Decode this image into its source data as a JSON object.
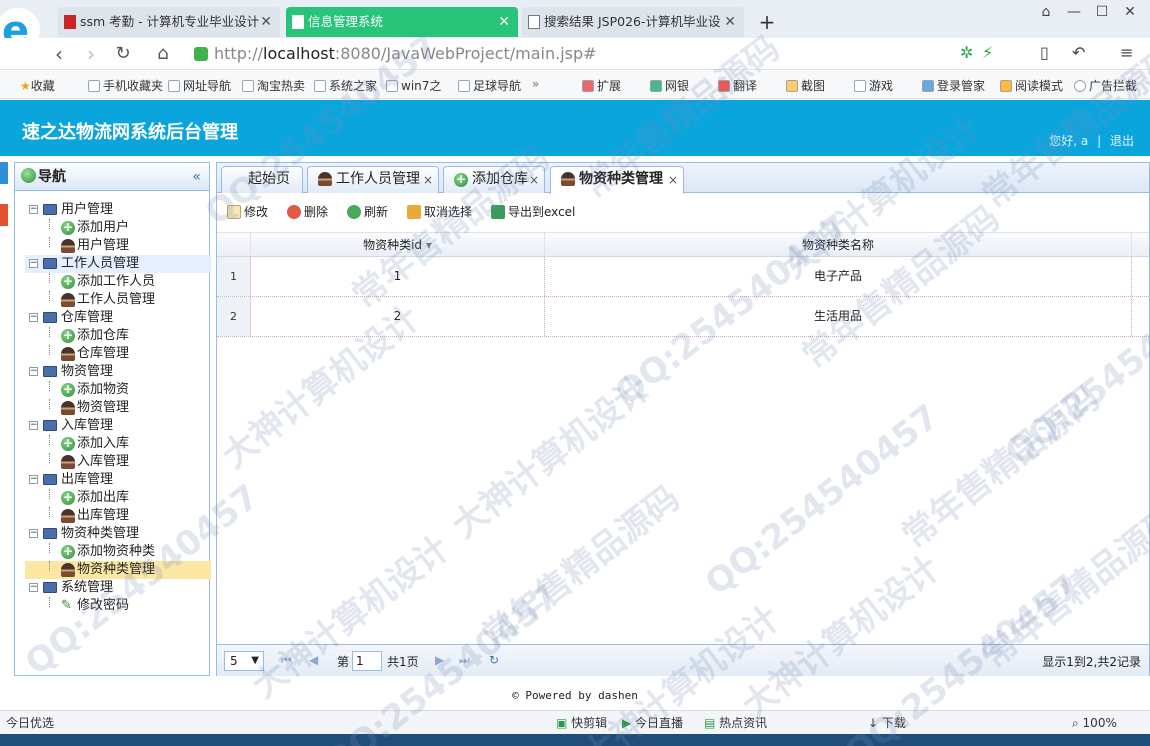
{
  "browser": {
    "tabs": [
      {
        "label": "ssm 考勤 - 计算机专业毕业设计"
      },
      {
        "label": "信息管理系统"
      },
      {
        "label": "搜索结果 JSP026-计算机毕业设"
      }
    ],
    "url_prefix": "http://",
    "url_host": "localhost",
    "url_rest": ":8080/JavaWebProject/main.jsp#",
    "bookmarks": [
      "收藏",
      "手机收藏夹",
      "网址导航",
      "淘宝热卖",
      "系统之家",
      "win7之",
      "足球导航",
      "扩展",
      "网银",
      "翻译",
      "截图",
      "游戏",
      "登录管家",
      "阅读模式",
      "广告拦截"
    ],
    "more_label": "»"
  },
  "app": {
    "title": "速之达物流网系统后台管理",
    "greeting": "您好, a",
    "separator": "|",
    "logout": "退出"
  },
  "nav": {
    "title": "导航",
    "collapse": "«",
    "tree": [
      {
        "label": "用户管理",
        "children": [
          {
            "label": "添加用户",
            "icon": "plus"
          },
          {
            "label": "用户管理",
            "icon": "user"
          }
        ]
      },
      {
        "label": "工作人员管理",
        "children": [
          {
            "label": "添加工作人员",
            "icon": "plus"
          },
          {
            "label": "工作人员管理",
            "icon": "user"
          }
        ]
      },
      {
        "label": "仓库管理",
        "children": [
          {
            "label": "添加仓库",
            "icon": "plus"
          },
          {
            "label": "仓库管理",
            "icon": "user"
          }
        ]
      },
      {
        "label": "物资管理",
        "children": [
          {
            "label": "添加物资",
            "icon": "plus"
          },
          {
            "label": "物资管理",
            "icon": "user"
          }
        ]
      },
      {
        "label": "入库管理",
        "children": [
          {
            "label": "添加入库",
            "icon": "plus"
          },
          {
            "label": "入库管理",
            "icon": "user"
          }
        ]
      },
      {
        "label": "出库管理",
        "children": [
          {
            "label": "添加出库",
            "icon": "plus"
          },
          {
            "label": "出库管理",
            "icon": "user"
          }
        ]
      },
      {
        "label": "物资种类管理",
        "children": [
          {
            "label": "添加物资种类",
            "icon": "plus"
          },
          {
            "label": "物资种类管理",
            "icon": "user"
          }
        ]
      },
      {
        "label": "系统管理",
        "children": [
          {
            "label": "修改密码",
            "icon": "pen"
          }
        ]
      }
    ]
  },
  "tabs": [
    {
      "label": "起始页",
      "closable": false
    },
    {
      "label": "工作人员管理",
      "closable": true
    },
    {
      "label": "添加仓库",
      "closable": true
    },
    {
      "label": "物资种类管理",
      "closable": true
    }
  ],
  "toolbar": {
    "edit": "修改",
    "delete": "删除",
    "refresh": "刷新",
    "cancel_select": "取消选择",
    "export": "导出到excel"
  },
  "grid": {
    "columns": [
      "物资种类id",
      "物资种类名称"
    ],
    "sort_indicator": "▾",
    "rows": [
      {
        "no": "1",
        "id": "1",
        "name": "电子产品"
      },
      {
        "no": "2",
        "id": "2",
        "name": "生活用品"
      }
    ]
  },
  "pager": {
    "page_size": "5",
    "page_prefix": "第",
    "page_value": "1",
    "page_total": "共1页",
    "summary": "显示1到2,共2记录"
  },
  "footer": "© Powered by dashen",
  "statusbar": {
    "left": "今日优选",
    "items": [
      "快剪辑",
      "今日直播",
      "热点资讯",
      "下载"
    ],
    "zoom": "100%"
  },
  "watermarks": [
    "QQ:254540457",
    "常年售精品源码",
    "大神计算机设计"
  ]
}
